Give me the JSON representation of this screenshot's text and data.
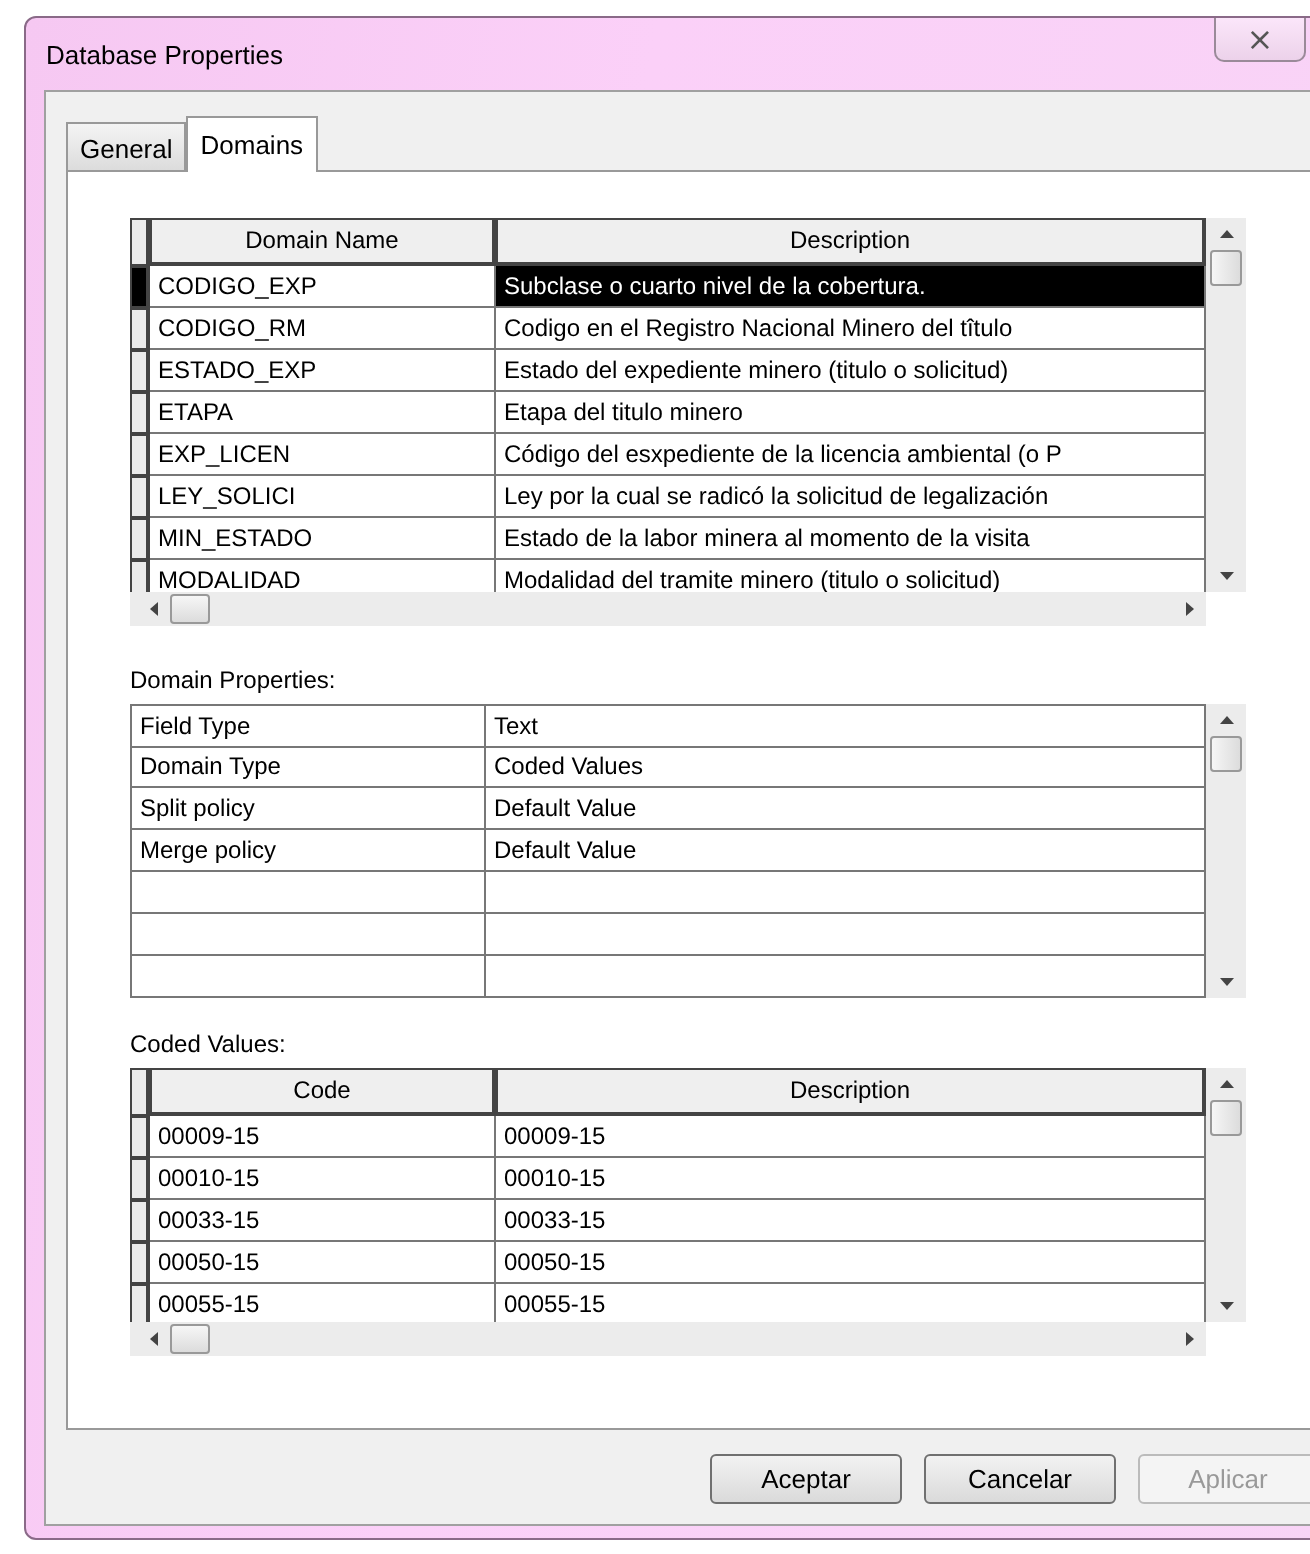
{
  "window": {
    "title": "Database Properties",
    "close": "×"
  },
  "tabs": [
    {
      "label": "General",
      "selected": false
    },
    {
      "label": "Domains",
      "selected": true
    }
  ],
  "domains": {
    "columns": [
      "Domain Name",
      "Description"
    ],
    "rows": [
      {
        "name": "CODIGO_EXP",
        "description": "Subclase o cuarto nivel de la cobertura.",
        "selected": true
      },
      {
        "name": "CODIGO_RM",
        "description": "Codigo en el Registro Nacional Minero del tîtulo",
        "selected": false
      },
      {
        "name": "ESTADO_EXP",
        "description": "Estado del expediente minero (titulo o solicitud)",
        "selected": false
      },
      {
        "name": "ETAPA",
        "description": "Etapa del titulo minero",
        "selected": false
      },
      {
        "name": "EXP_LICEN",
        "description": "Código del esxpediente de la licencia ambiental (o P",
        "selected": false
      },
      {
        "name": "LEY_SOLICI",
        "description": "Ley por la cual se radicó la solicitud de legalización",
        "selected": false
      },
      {
        "name": "MIN_ESTADO",
        "description": "Estado de la labor minera al momento de la visita",
        "selected": false
      },
      {
        "name": "MODALIDAD",
        "description": "Modalidad del tramite minero (titulo o solicitud)",
        "selected": false
      }
    ]
  },
  "domain_properties": {
    "label": "Domain Properties:",
    "rows": [
      {
        "property": "Field Type",
        "value": "Text"
      },
      {
        "property": "Domain Type",
        "value": "Coded Values"
      },
      {
        "property": "Split policy",
        "value": "Default Value"
      },
      {
        "property": "Merge policy",
        "value": "Default Value"
      }
    ]
  },
  "coded_values": {
    "label": "Coded Values:",
    "columns": [
      "Code",
      "Description"
    ],
    "rows": [
      {
        "code": "00009-15",
        "description": "00009-15"
      },
      {
        "code": "00010-15",
        "description": "00010-15"
      },
      {
        "code": "00033-15",
        "description": "00033-15"
      },
      {
        "code": "00050-15",
        "description": "00050-15"
      },
      {
        "code": "00055-15",
        "description": "00055-15"
      }
    ]
  },
  "buttons": [
    {
      "label": "Aceptar",
      "disabled": false
    },
    {
      "label": "Cancelar",
      "disabled": false
    },
    {
      "label": "Aplicar",
      "disabled": true
    }
  ]
}
